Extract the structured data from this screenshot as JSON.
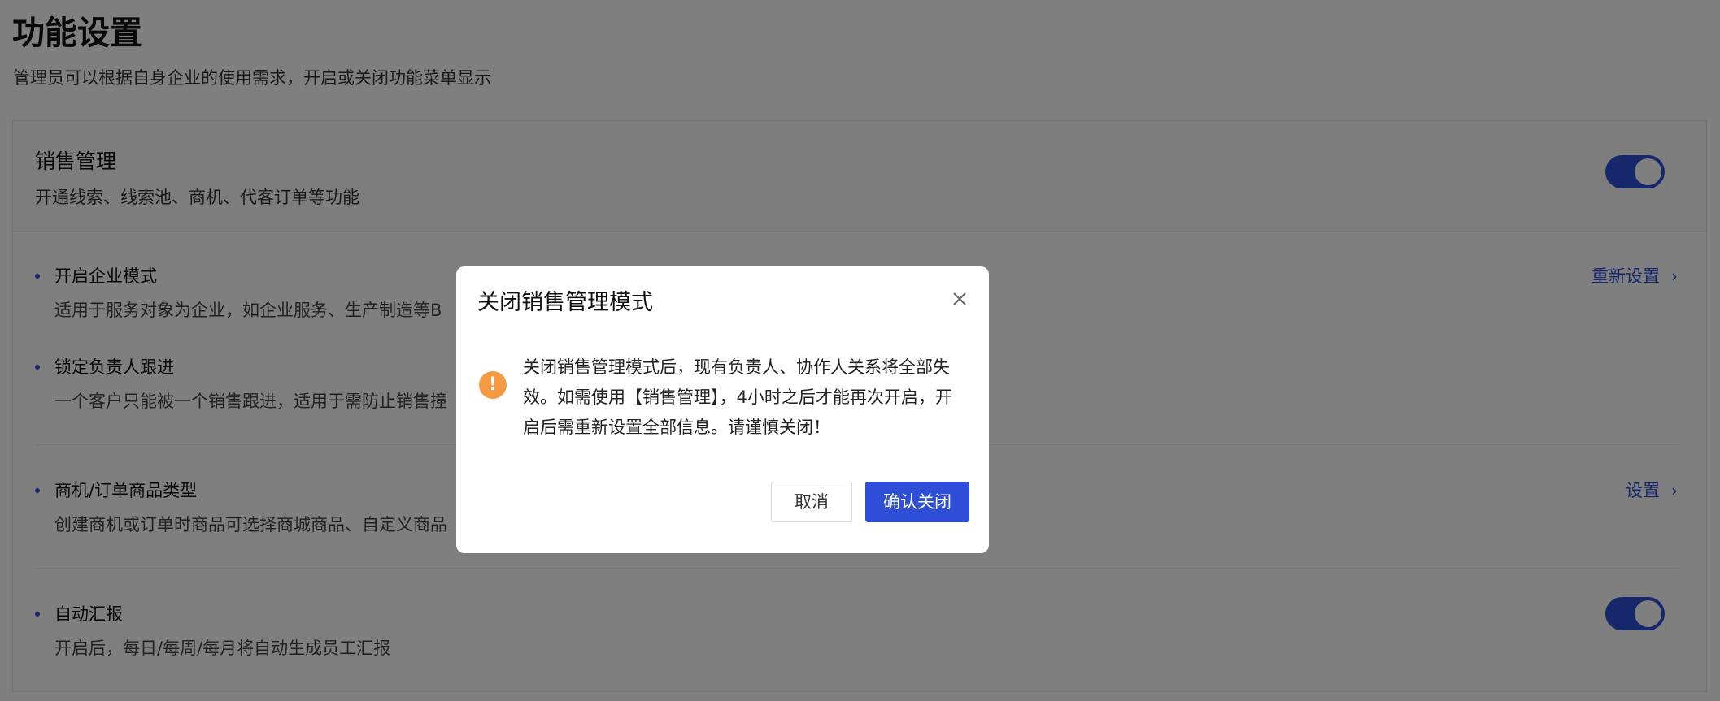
{
  "page": {
    "title": "功能设置",
    "subtitle": "管理员可以根据自身企业的使用需求，开启或关闭功能菜单显示"
  },
  "sales_management": {
    "title": "销售管理",
    "description": "开通线索、线索池、商机、代客订单等功能",
    "toggle_on": true
  },
  "items": [
    {
      "title": "开启企业模式",
      "description": "适用于服务对象为企业，如企业服务、生产制造等B",
      "link": "重新设置"
    },
    {
      "title": "锁定负责人跟进",
      "description": "一个客户只能被一个销售跟进，适用于需防止销售撞"
    },
    {
      "title": "商机/订单商品类型",
      "description": "创建商机或订单时商品可选择商城商品、自定义商品",
      "link": "设置"
    },
    {
      "title": "自动汇报",
      "description": "开启后，每日/每周/每月将自动生成员工汇报",
      "toggle_on": true
    }
  ],
  "modal": {
    "title": "关闭销售管理模式",
    "message": "关闭销售管理模式后，现有负责人、协作人关系将全部失效。如需使用【销售管理】，4小时之后才能再次开启，开启后需重新设置全部信息。请谨慎关闭！",
    "cancel_label": "取消",
    "confirm_label": "确认关闭",
    "warning_glyph": "!"
  },
  "colors": {
    "accent": "#2f4ed8",
    "warning": "#f59a43",
    "overlay": "rgba(0,0,0,0.5)"
  }
}
